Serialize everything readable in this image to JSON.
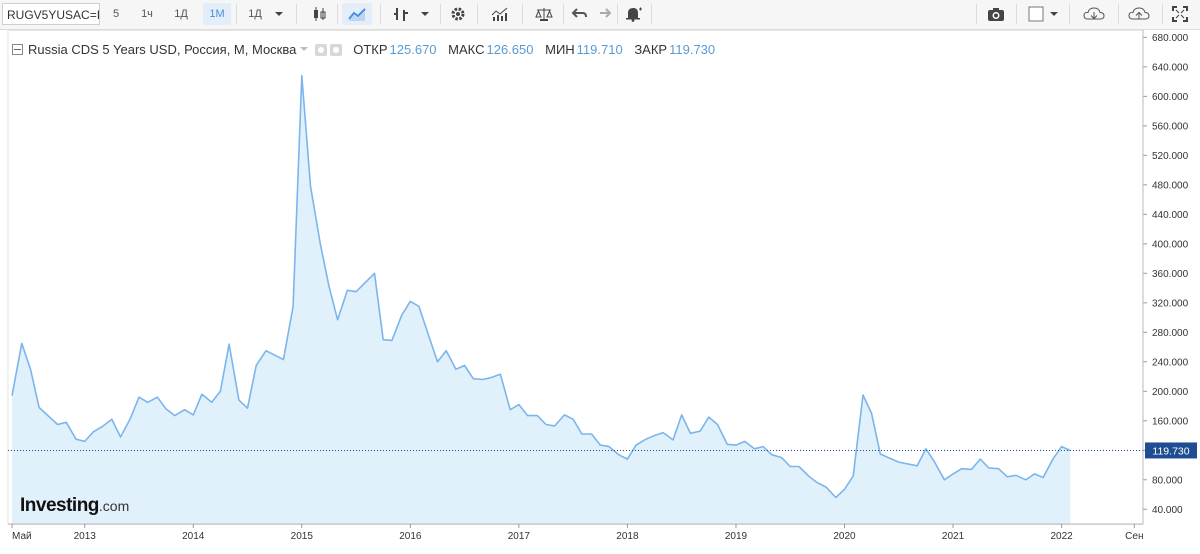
{
  "toolbar": {
    "symbol": "RUGV5YUSAC=I",
    "intervals": [
      "5",
      "1ч",
      "1Д",
      "1М",
      "1Д"
    ],
    "active_interval": "1М",
    "icons": [
      "dropdown-icon",
      "candlestick-icon",
      "area-chart-icon",
      "bar-chart-icon",
      "dropdown-icon",
      "settings-icon",
      "indicators-icon",
      "compare-icon",
      "undo-icon",
      "redo-icon",
      "alert-icon",
      "camera-icon",
      "color-box-icon",
      "dropdown-icon",
      "cloud-download-icon",
      "cloud-upload-icon",
      "fullscreen-icon"
    ]
  },
  "legend": {
    "title": "Russia CDS 5 Years USD, Россия, М, Москва",
    "open_label": "ОТКР",
    "open": "125.670",
    "high_label": "МАКС",
    "high": "126.650",
    "low_label": "МИН",
    "low": "119.710",
    "close_label": "ЗАКР",
    "close": "119.730"
  },
  "logo": {
    "brand": "Investing",
    "suffix": ".com"
  },
  "colors": {
    "line": "#7cb5ec",
    "fill": "#e1f1fb",
    "last_price_bg": "#1f4d91",
    "dotted": "#1f4d91"
  },
  "chart_data": {
    "type": "area",
    "title": "Russia CDS 5 Years USD",
    "ylim": [
      20,
      690
    ],
    "yticks": [
      40,
      80,
      120,
      160,
      200,
      240,
      280,
      320,
      360,
      400,
      440,
      480,
      520,
      560,
      600,
      640,
      680
    ],
    "ytick_labels": [
      "40.000",
      "80.000",
      "120.000",
      "160.000",
      "200.000",
      "240.000",
      "280.000",
      "320.000",
      "360.000",
      "400.000",
      "440.000",
      "480.000",
      "520.000",
      "560.000",
      "600.000",
      "640.000",
      "680.000"
    ],
    "xlim": [
      2012.33,
      2022.75
    ],
    "xticks": [
      2012.33,
      2013,
      2014,
      2015,
      2016,
      2017,
      2018,
      2019,
      2020,
      2021,
      2022,
      2022.67
    ],
    "xtick_labels": [
      "Май",
      "2013",
      "2014",
      "2015",
      "2016",
      "2017",
      "2018",
      "2019",
      "2020",
      "2021",
      "2022",
      "Сен"
    ],
    "last_value": 119.73,
    "last_label": "119.730",
    "series": [
      {
        "x": [
          2012.33,
          2012.42,
          2012.5,
          2012.58,
          2012.75,
          2012.83,
          2012.92,
          2013.0,
          2013.08,
          2013.17,
          2013.25,
          2013.33,
          2013.42,
          2013.5,
          2013.58,
          2013.67,
          2013.75,
          2013.83,
          2013.92,
          2014.0,
          2014.08,
          2014.17,
          2014.25,
          2014.33,
          2014.42,
          2014.5,
          2014.58,
          2014.67,
          2014.83,
          2014.92,
          2015.0,
          2015.08,
          2015.17,
          2015.25,
          2015.33,
          2015.42,
          2015.5,
          2015.67,
          2015.75,
          2015.83,
          2015.92,
          2016.0,
          2016.08,
          2016.17,
          2016.25,
          2016.33,
          2016.42,
          2016.5,
          2016.58,
          2016.67,
          2016.75,
          2016.83,
          2016.92,
          2017.0,
          2017.08,
          2017.17,
          2017.25,
          2017.33,
          2017.42,
          2017.5,
          2017.58,
          2017.67,
          2017.75,
          2017.83,
          2017.92,
          2018.0,
          2018.08,
          2018.17,
          2018.25,
          2018.33,
          2018.42,
          2018.5,
          2018.58,
          2018.67,
          2018.75,
          2018.83,
          2018.92,
          2019.0,
          2019.08,
          2019.17,
          2019.25,
          2019.33,
          2019.42,
          2019.5,
          2019.58,
          2019.67,
          2019.75,
          2019.83,
          2019.92,
          2020.0,
          2020.08,
          2020.17,
          2020.25,
          2020.33,
          2020.42,
          2020.5,
          2020.67,
          2020.75,
          2020.83,
          2020.92,
          2021.0,
          2021.08,
          2021.17,
          2021.25,
          2021.33,
          2021.42,
          2021.5,
          2021.58,
          2021.67,
          2021.75,
          2021.83,
          2021.92,
          2022.0,
          2022.08
        ],
        "y": [
          194,
          265,
          230,
          178,
          155,
          158,
          135,
          132,
          145,
          153,
          162,
          138,
          163,
          192,
          185,
          192,
          176,
          167,
          175,
          168,
          196,
          185,
          200,
          264,
          188,
          177,
          235,
          255,
          243,
          315,
          628,
          478,
          400,
          343,
          297,
          337,
          335,
          360,
          270,
          269,
          303,
          322,
          315,
          275,
          240,
          255,
          230,
          235,
          217,
          216,
          219,
          223,
          175,
          182,
          167,
          167,
          155,
          153,
          168,
          162,
          142,
          142,
          127,
          125,
          114,
          108,
          127,
          135,
          140,
          144,
          134,
          168,
          143,
          146,
          165,
          155,
          128,
          127,
          132,
          122,
          125,
          114,
          110,
          98,
          98,
          85,
          76,
          70,
          56,
          67,
          85,
          195,
          170,
          115,
          109,
          104,
          99,
          122,
          104,
          80,
          88,
          95,
          94,
          108,
          96,
          95,
          84,
          86,
          80,
          88,
          83,
          108,
          125,
          119.73
        ]
      }
    ]
  }
}
